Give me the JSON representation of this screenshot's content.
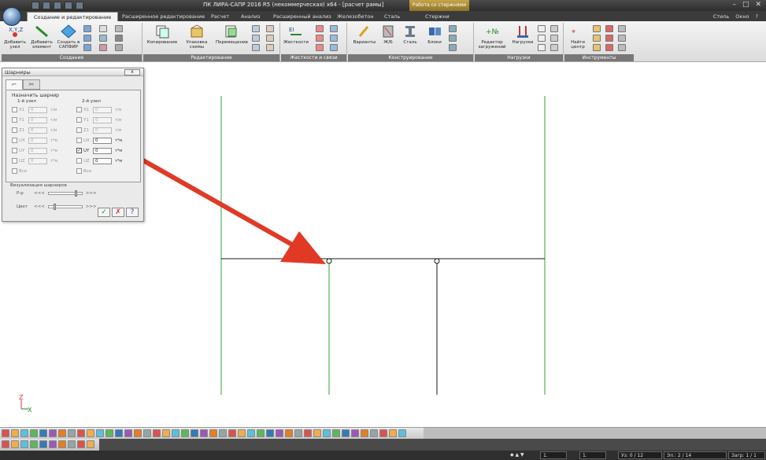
{
  "window": {
    "title": "ПК ЛИРА-САПР  2016 R5 (некоммерческая) x64 - [расчет рамы]",
    "context_tab_group": "Работа со стержнями",
    "right_menus": [
      "Стиль",
      "Окно",
      "?"
    ]
  },
  "ribbon": {
    "tabs": [
      {
        "label": "Создание и редактирование",
        "active": true
      },
      {
        "label": "Расширенное редактирование"
      },
      {
        "label": "Расчет"
      },
      {
        "label": "Анализ"
      },
      {
        "label": "Расширенный анализ"
      },
      {
        "label": "Железобетон"
      },
      {
        "label": "Сталь"
      },
      {
        "label": "Стержни"
      }
    ],
    "groups": {
      "create": {
        "label": "Создание",
        "buttons": [
          {
            "label": "Добавить узел"
          },
          {
            "label": "Добавить элемент"
          },
          {
            "label": "Создать в САПФИР"
          }
        ]
      },
      "edit": {
        "label": "Редактирование",
        "buttons": [
          {
            "label": "Копирование"
          },
          {
            "label": "Упаковка схемы"
          },
          {
            "label": "Перемещение"
          }
        ]
      },
      "stiffness": {
        "label": "Жесткости и связи",
        "buttons": [
          {
            "label": "Жесткости"
          }
        ]
      },
      "design": {
        "label": "Конструирование",
        "buttons": [
          {
            "label": "Варианты"
          },
          {
            "label": "Ж/Б"
          },
          {
            "label": "Сталь"
          },
          {
            "label": "Блоки"
          }
        ]
      },
      "loads": {
        "label": "Нагрузки",
        "buttons": [
          {
            "label": "Редактор загружений"
          },
          {
            "label": "Нагрузки"
          }
        ]
      },
      "tools": {
        "label": "Инструменты",
        "buttons": [
          {
            "label": "Найти центр"
          }
        ]
      }
    }
  },
  "dialog": {
    "title": "Шарниры",
    "close_label": "x",
    "tabs": [
      "⌐",
      "✂"
    ],
    "assign_label": "Назначить шарнир",
    "node1_label": "1-й узел",
    "node2_label": "2-й узел",
    "node1": [
      {
        "dof": "X1",
        "value": "0",
        "unit": "т/м",
        "checked": false
      },
      {
        "dof": "Y1",
        "value": "0",
        "unit": "т/м",
        "checked": false
      },
      {
        "dof": "Z1",
        "value": "0",
        "unit": "т/м",
        "checked": false
      },
      {
        "dof": "UX",
        "value": "0",
        "unit": "т*м",
        "checked": false
      },
      {
        "dof": "UY",
        "value": "0",
        "unit": "т*м",
        "checked": false
      },
      {
        "dof": "UZ",
        "value": "0",
        "unit": "т*м",
        "checked": false
      }
    ],
    "node2": [
      {
        "dof": "X1",
        "value": "0",
        "unit": "т/м",
        "checked": false
      },
      {
        "dof": "Y1",
        "value": "0",
        "unit": "т/м",
        "checked": false
      },
      {
        "dof": "Z1",
        "value": "0",
        "unit": "т/м",
        "checked": false
      },
      {
        "dof": "UX",
        "value": "0",
        "unit": "т*м",
        "checked": false
      },
      {
        "dof": "UY",
        "value": "0",
        "unit": "т*м",
        "checked": true
      },
      {
        "dof": "UZ",
        "value": "0",
        "unit": "т*м",
        "checked": false
      }
    ],
    "all_label": "Все",
    "visualization_label": "Визуализация шарниров",
    "size_label": "Р-р",
    "color_label": "Цвет",
    "slider_left": "<<<",
    "slider_right": ">>>",
    "size_level": 0.85,
    "color_level": 0.15,
    "ok_symbol": "✓",
    "cancel_symbol": "✗",
    "help_symbol": "?"
  },
  "axes": {
    "z_label": "Z",
    "x_label": "X"
  },
  "status_bar": {
    "load_value": "1.",
    "load_value2": "1.",
    "nodes": "Уз: 0 / 12",
    "elements": "Эл.: 2 / 14",
    "loads": "Загр: 1 / 1"
  },
  "colors": {
    "arrow": "#e03a26",
    "members": "#1a1a1a",
    "supports": "#2fa52f",
    "ribbon_label": "#777777"
  }
}
